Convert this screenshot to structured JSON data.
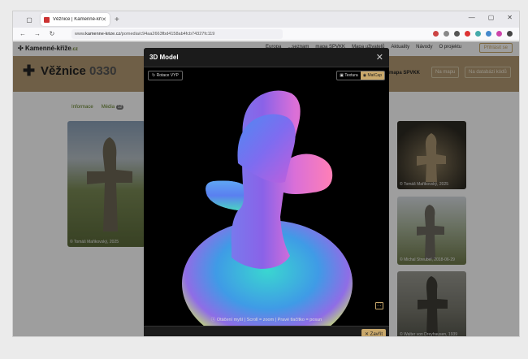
{
  "browser": {
    "tab_title": "Věžnice | Kamenné-kříže.cz",
    "url_prefix": "www.",
    "url_domain": "kamenne-krize.cz",
    "url_path": "/pomedia/c94aa2663fbd4158ab4fcb74327fc119"
  },
  "site": {
    "logo": "Kamenné-kříže",
    "logo_tld": ".cz",
    "menu": [
      "Europa",
      "...seznam",
      "mapa SPVKK",
      "Mapa uživatelů",
      "Aktuality",
      "Návody",
      "O projektu"
    ],
    "login": "Přihlásit se"
  },
  "hero": {
    "icon": "cross-icon",
    "title": "Věžnice",
    "code": "0330",
    "map_label": "mapa SPVKK",
    "btn_map": "Na mapu",
    "btn_db": "Na databázi kódů"
  },
  "page_tabs": {
    "info": "Informace",
    "media": "Média",
    "media_count": "12"
  },
  "photos": {
    "left_caption": "© Tomáš Mařikovský, 2025",
    "right": [
      "© Tomáš Mařikovský, 2025",
      "© Michal Streubel, 2018-06-29",
      "© Walter von Dreyhausen, 1939"
    ]
  },
  "modal": {
    "title": "3D Model",
    "rotate_button": "Rotace VYP",
    "texture_button": "Textura",
    "matcap_button": "MatCap",
    "hint": "Otáčení myší | Scroll = zoom | Pravé tlačítko = posun",
    "close_button": "Zavřít"
  },
  "colors": {
    "accent": "#c9a86b",
    "hero_bg": "#b39a73",
    "modal_bg": "#000000"
  }
}
